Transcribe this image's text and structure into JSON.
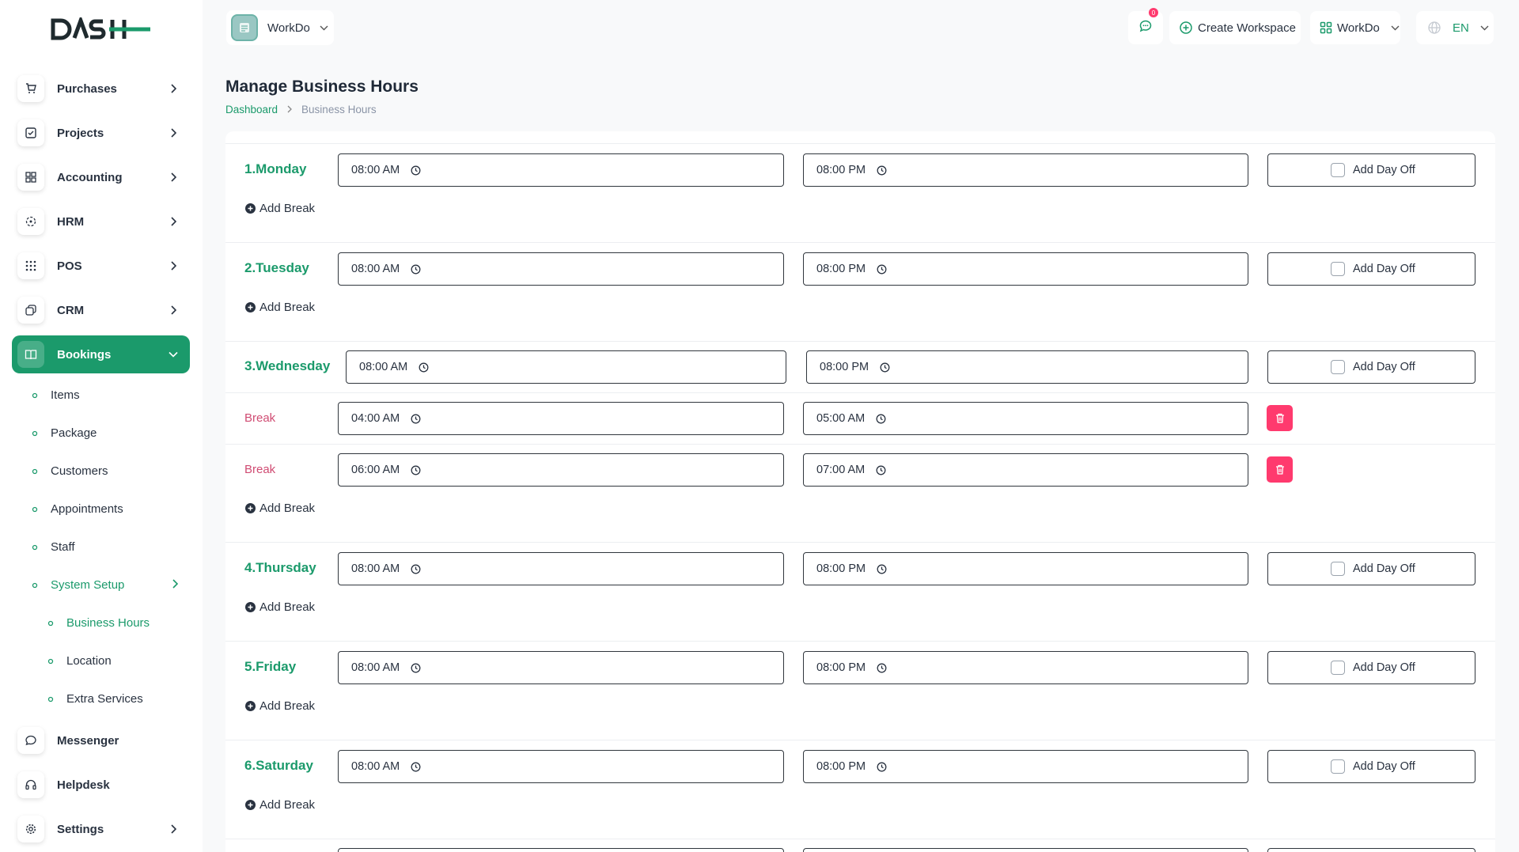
{
  "brand": {
    "logo_text": "DASH"
  },
  "topbar": {
    "workspace_name": "WorkDo",
    "notification_count": "0",
    "create_workspace_label": "Create Workspace",
    "workspace_switch_label": "WorkDo",
    "language": "EN"
  },
  "sidebar": {
    "items": [
      {
        "label": "Purchases",
        "icon": "cart-icon"
      },
      {
        "label": "Projects",
        "icon": "checkbox-icon"
      },
      {
        "label": "Accounting",
        "icon": "grid-icon"
      },
      {
        "label": "HRM",
        "icon": "hrm-icon"
      },
      {
        "label": "POS",
        "icon": "dots-grid-icon"
      },
      {
        "label": "CRM",
        "icon": "layers-icon"
      },
      {
        "label": "Bookings",
        "icon": "book-icon"
      },
      {
        "label": "Messenger",
        "icon": "chat-icon"
      },
      {
        "label": "Helpdesk",
        "icon": "headset-icon"
      },
      {
        "label": "Settings",
        "icon": "gear-icon"
      }
    ],
    "bookings_sub": [
      "Items",
      "Package",
      "Customers",
      "Appointments",
      "Staff",
      "System Setup"
    ],
    "system_setup_sub": [
      "Business Hours",
      "Location",
      "Extra Services"
    ]
  },
  "page": {
    "title": "Manage Business Hours",
    "breadcrumb_home": "Dashboard",
    "breadcrumb_current": "Business Hours"
  },
  "labels": {
    "add_break": "Add Break",
    "add_day_off": "Add Day Off",
    "break": "Break"
  },
  "days": [
    {
      "label": "1.Monday",
      "start": "08:00 AM",
      "end": "08:00 PM"
    },
    {
      "label": "2.Tuesday",
      "start": "08:00 AM",
      "end": "08:00 PM"
    },
    {
      "label": "3.Wednesday",
      "start": "08:00 AM",
      "end": "08:00 PM",
      "breaks": [
        {
          "start": "04:00 AM",
          "end": "05:00 AM"
        },
        {
          "start": "06:00 AM",
          "end": "07:00 AM"
        }
      ]
    },
    {
      "label": "4.Thursday",
      "start": "08:00 AM",
      "end": "08:00 PM"
    },
    {
      "label": "5.Friday",
      "start": "08:00 AM",
      "end": "08:00 PM"
    },
    {
      "label": "6.Saturday",
      "start": "08:00 AM",
      "end": "08:00 PM"
    }
  ],
  "colors": {
    "accent": "#1b9a6b",
    "danger": "#ff3a6e",
    "break_text": "#d04c73"
  }
}
